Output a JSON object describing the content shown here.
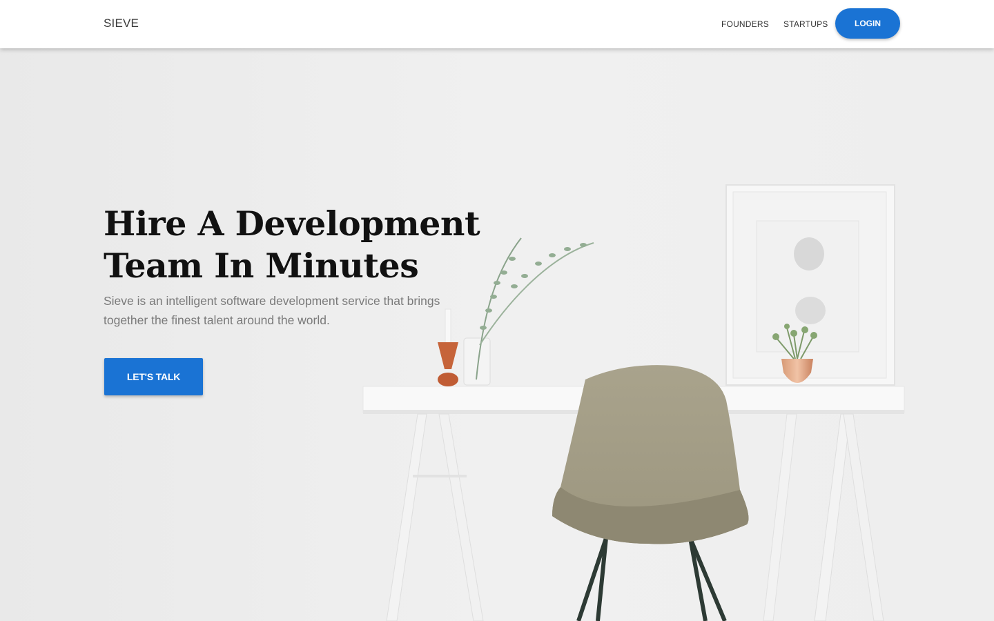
{
  "navbar": {
    "brand": "SIEVE",
    "links": [
      {
        "label": "FOUNDERS"
      },
      {
        "label": "STARTUPS"
      }
    ],
    "login_label": "LOGIN"
  },
  "hero": {
    "headline_line1": "Hire A Development",
    "headline_line2": "Team In Minutes",
    "subtitle_line1": "Sieve is an intelligent software development service that brings",
    "subtitle_line2": "together the finest talent around the world.",
    "cta_label": "LET'S TALK"
  },
  "colors": {
    "accent": "#1a73d4",
    "navbar_bg": "#ffffff",
    "headline": "#111111",
    "subtitle": "#7a7a7a"
  }
}
